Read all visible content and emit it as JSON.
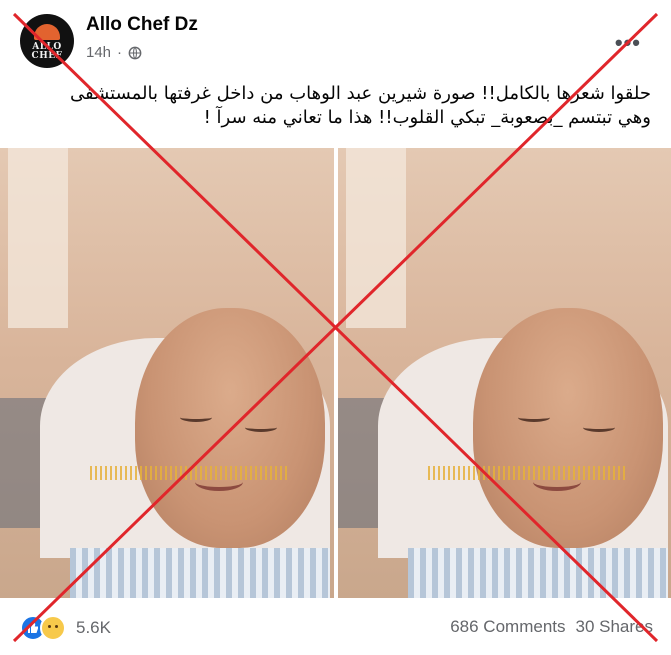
{
  "post": {
    "author": "Allo Chef Dz",
    "avatar_text": "ALLO CHEF",
    "time": "14h",
    "privacy_icon": "globe-icon",
    "more_label": "•••",
    "caption_line1": "حلقوا شعرها بالكامل!! صورة شيرين عبد الوهاب من داخل غرفتها بالمستشفى",
    "caption_line2": "وهي تبتسم _بصعوبة_ تبكي القلوب!! هذا ما تعاني منه سرآ !"
  },
  "overlay": {
    "mark": "x-mark",
    "color": "#e0262b"
  },
  "footer": {
    "reactions": [
      "like-icon",
      "sad-icon"
    ],
    "reaction_count": "5.6K",
    "comments": "686 Comments",
    "shares": "30 Shares"
  },
  "colors": {
    "secondary_text": "#65676b",
    "like_blue": "#1b74e4"
  }
}
